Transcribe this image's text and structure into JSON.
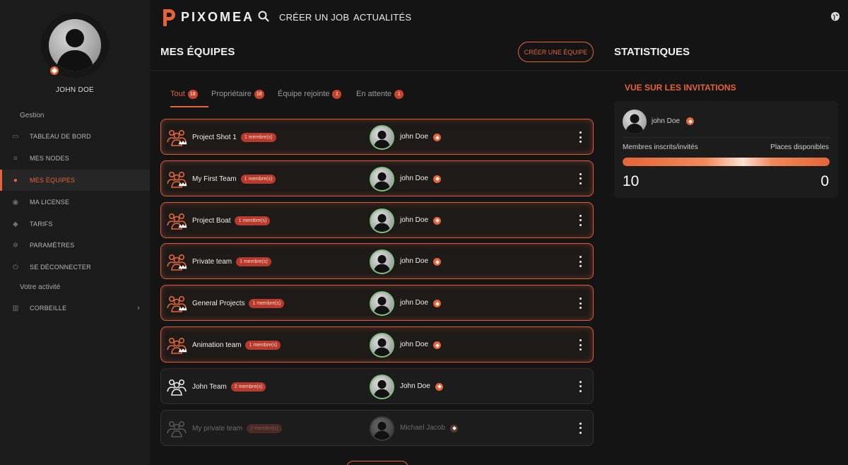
{
  "colors": {
    "accent": "#e3643a",
    "background": "#141414",
    "sidebar": "#1b1b1b",
    "badge": "#c8432d"
  },
  "sidebar": {
    "user_name": "JOHN DOE",
    "section_gestion": "Gestion",
    "items": [
      {
        "label": "TABLEAU DE BORD",
        "icon": "dashboard-icon",
        "active": false
      },
      {
        "label": "MES NODES",
        "icon": "nodes-icon",
        "active": false
      },
      {
        "label": "MES ÉQUIPES",
        "icon": "user-icon",
        "active": true
      },
      {
        "label": "MA LICENSE",
        "icon": "license-icon",
        "active": false
      },
      {
        "label": "TARIFS",
        "icon": "pricing-icon",
        "active": false
      },
      {
        "label": "PARAMÈTRES",
        "icon": "gear-icon",
        "active": false
      },
      {
        "label": "SE DÉCONNECTER",
        "icon": "power-icon",
        "active": false
      }
    ],
    "section_activity": "Votre activité",
    "trash_label": "CORBEILLE"
  },
  "header": {
    "logo_text": "PIXOMEA",
    "link_create_job": "CRÉER UN JOB",
    "link_news": "ACTUALITÉS"
  },
  "teams_panel": {
    "title": "MES ÉQUIPES",
    "create_button": "CRÉER UNE ÉQUIPE",
    "tabs": [
      {
        "label": "Tout",
        "count": "18",
        "active": true
      },
      {
        "label": "Propriétaire",
        "count": "18",
        "active": false
      },
      {
        "label": "Équipe rejointe",
        "count": "1",
        "active": false
      },
      {
        "label": "En attente",
        "count": "1",
        "active": false
      }
    ],
    "teams": [
      {
        "name": "Project Shot 1",
        "members": "1 membre(s)",
        "owner": "john Doe",
        "role": "owner"
      },
      {
        "name": "My First Team",
        "members": "1 membre(s)",
        "owner": "john Doe",
        "role": "owner"
      },
      {
        "name": "Project Boat",
        "members": "1 membre(s)",
        "owner": "john Doe",
        "role": "owner"
      },
      {
        "name": "Private team",
        "members": "1 membre(s)",
        "owner": "john Doe",
        "role": "owner"
      },
      {
        "name": "General Projects",
        "members": "1 membre(s)",
        "owner": "john Doe",
        "role": "owner"
      },
      {
        "name": "Animation team",
        "members": "1 membre(s)",
        "owner": "john Doe",
        "role": "owner"
      },
      {
        "name": "John Team",
        "members": "2 membre(s)",
        "owner": "John Doe",
        "role": "member"
      },
      {
        "name": "My private team",
        "members": "2 membre(s)",
        "owner": "Michael Jacob",
        "role": "pending"
      }
    ]
  },
  "stats": {
    "title": "STATISTIQUES",
    "invitations_title": "VUE SUR LES INVITATIONS",
    "user": "john Doe",
    "label_members": "Membres inscrits/invités",
    "label_places": "Places disponibles",
    "members_count": "10",
    "places_count": "0",
    "progress_fraction": 1.0
  }
}
